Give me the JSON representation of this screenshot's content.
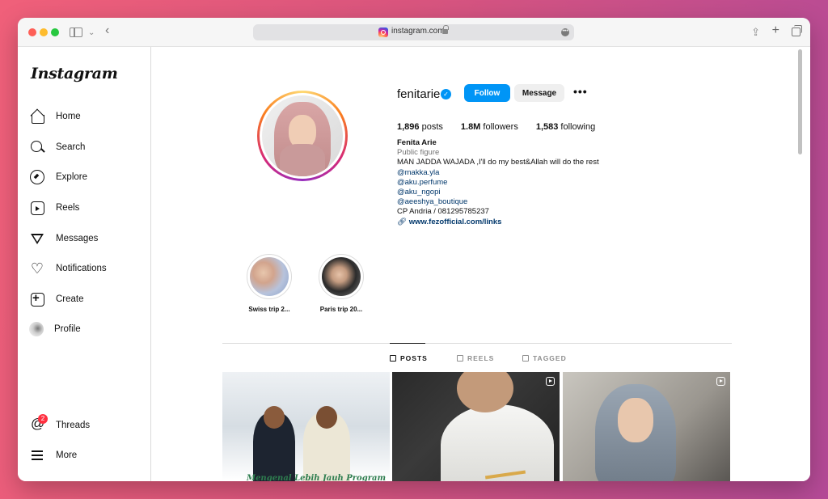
{
  "browser": {
    "url": "instagram.com"
  },
  "sidebar": {
    "logo": "Instagram",
    "items": [
      {
        "label": "Home",
        "icon": "home-icon"
      },
      {
        "label": "Search",
        "icon": "search-icon"
      },
      {
        "label": "Explore",
        "icon": "compass-icon"
      },
      {
        "label": "Reels",
        "icon": "reels-icon"
      },
      {
        "label": "Messages",
        "icon": "paper-plane-icon"
      },
      {
        "label": "Notifications",
        "icon": "heart-icon"
      },
      {
        "label": "Create",
        "icon": "plus-square-icon"
      },
      {
        "label": "Profile",
        "icon": "profile-avatar-icon"
      }
    ],
    "threads": {
      "label": "Threads",
      "badge": "2"
    },
    "more": {
      "label": "More"
    }
  },
  "profile": {
    "username": "fenitarie",
    "follow_label": "Follow",
    "message_label": "Message",
    "more_label": "•••",
    "stats": {
      "posts_count": "1,896",
      "posts_label": "posts",
      "followers_count": "1.8M",
      "followers_label": "followers",
      "following_count": "1,583",
      "following_label": "following"
    },
    "bio": {
      "name": "Fenita Arie",
      "category": "Public figure",
      "line1": "MAN JADDA WAJADA ,I'll do my best&Allah will do the rest",
      "mention1": "@makka.yla",
      "mention2": "@aku.perfume",
      "mention3": "@aku_ngopi",
      "mention4": "@aeeshya_boutique",
      "contact": "CP Andria / 081295785237",
      "link": "www.fezofficial.com/links"
    }
  },
  "highlights": [
    {
      "label": "Swiss trip 2..."
    },
    {
      "label": "Paris trip 20..."
    }
  ],
  "tabs": {
    "posts": "POSTS",
    "reels": "REELS",
    "tagged": "TAGGED"
  },
  "posts": {
    "post1_caption": "Mengenal Lebih Jauh Program"
  },
  "colors": {
    "accent": "#0095f6",
    "badge": "#ff3040",
    "link": "#00376b"
  }
}
